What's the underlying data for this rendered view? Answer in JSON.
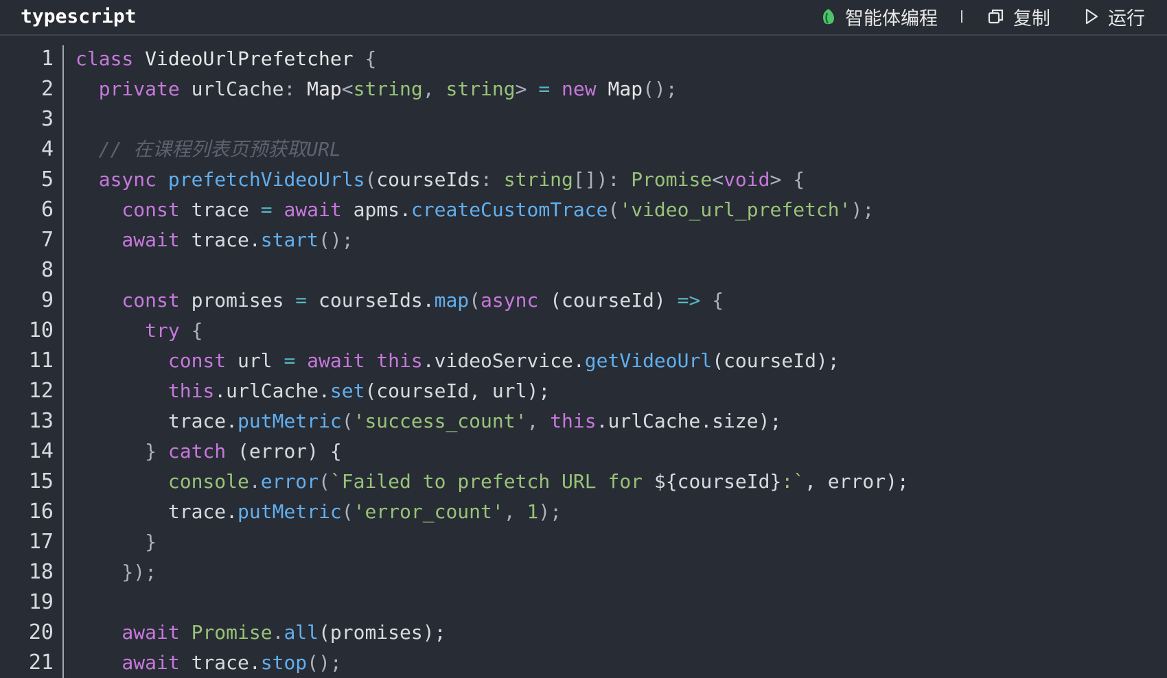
{
  "header": {
    "language": "typescript",
    "agent_label": "智能体编程",
    "copy_label": "复制",
    "run_label": "运行"
  },
  "colors": {
    "background": "#282c34",
    "keyword": "#c678dd",
    "function": "#61afef",
    "string": "#98c379",
    "comment": "#5c6370",
    "agent_icon": "#4cc46a"
  },
  "icons": {
    "agent": "leaf-icon",
    "copy": "copy-icon",
    "run": "play-icon"
  },
  "line_numbers": [
    "1",
    "2",
    "3",
    "4",
    "5",
    "6",
    "7",
    "8",
    "9",
    "10",
    "11",
    "12",
    "13",
    "14",
    "15",
    "16",
    "17",
    "18",
    "19",
    "20",
    "21"
  ],
  "code_lines": [
    [
      {
        "t": "class",
        "c": "kw"
      },
      {
        "t": " VideoUrlPrefetcher ",
        "c": "cls"
      },
      {
        "t": "{",
        "c": "plain"
      }
    ],
    [
      {
        "t": "  private",
        "c": "kw"
      },
      {
        "t": " urlCache",
        "c": "id"
      },
      {
        "t": ": ",
        "c": "plain"
      },
      {
        "t": "Map",
        "c": "cls"
      },
      {
        "t": "<",
        "c": "plain"
      },
      {
        "t": "string",
        "c": "ty"
      },
      {
        "t": ", ",
        "c": "plain"
      },
      {
        "t": "string",
        "c": "ty"
      },
      {
        "t": "> ",
        "c": "plain"
      },
      {
        "t": "=",
        "c": "op"
      },
      {
        "t": " new",
        "c": "kw"
      },
      {
        "t": " Map",
        "c": "cls"
      },
      {
        "t": "();",
        "c": "plain"
      }
    ],
    [],
    [
      {
        "t": "  // 在课程列表页预获取URL",
        "c": "cm"
      }
    ],
    [
      {
        "t": "  async",
        "c": "kw"
      },
      {
        "t": " prefetchVideoUrls",
        "c": "fn"
      },
      {
        "t": "(",
        "c": "plain"
      },
      {
        "t": "courseIds",
        "c": "id"
      },
      {
        "t": ": ",
        "c": "plain"
      },
      {
        "t": "string",
        "c": "ty"
      },
      {
        "t": "[]): ",
        "c": "plain"
      },
      {
        "t": "Promise",
        "c": "ty"
      },
      {
        "t": "<",
        "c": "plain"
      },
      {
        "t": "void",
        "c": "kw"
      },
      {
        "t": "> {",
        "c": "plain"
      }
    ],
    [
      {
        "t": "    const",
        "c": "kw"
      },
      {
        "t": " trace ",
        "c": "id"
      },
      {
        "t": "=",
        "c": "op"
      },
      {
        "t": " await",
        "c": "kw"
      },
      {
        "t": " apms.",
        "c": "id"
      },
      {
        "t": "createCustomTrace",
        "c": "fn"
      },
      {
        "t": "(",
        "c": "plain"
      },
      {
        "t": "'video_url_prefetch'",
        "c": "str"
      },
      {
        "t": ");",
        "c": "plain"
      }
    ],
    [
      {
        "t": "    await",
        "c": "kw"
      },
      {
        "t": " trace.",
        "c": "id"
      },
      {
        "t": "start",
        "c": "fn"
      },
      {
        "t": "();",
        "c": "plain"
      }
    ],
    [],
    [
      {
        "t": "    const",
        "c": "kw"
      },
      {
        "t": " promises ",
        "c": "id"
      },
      {
        "t": "=",
        "c": "op"
      },
      {
        "t": " courseIds.",
        "c": "id"
      },
      {
        "t": "map",
        "c": "fn"
      },
      {
        "t": "(",
        "c": "plain"
      },
      {
        "t": "async",
        "c": "kw"
      },
      {
        "t": " (courseId) ",
        "c": "id"
      },
      {
        "t": "=>",
        "c": "op"
      },
      {
        "t": " {",
        "c": "plain"
      }
    ],
    [
      {
        "t": "      try",
        "c": "kw"
      },
      {
        "t": " {",
        "c": "plain"
      }
    ],
    [
      {
        "t": "        const",
        "c": "kw"
      },
      {
        "t": " url ",
        "c": "id"
      },
      {
        "t": "=",
        "c": "op"
      },
      {
        "t": " await",
        "c": "kw"
      },
      {
        "t": " this",
        "c": "kw"
      },
      {
        "t": ".videoService.",
        "c": "id"
      },
      {
        "t": "getVideoUrl",
        "c": "fn"
      },
      {
        "t": "(courseId);",
        "c": "id"
      }
    ],
    [
      {
        "t": "        this",
        "c": "kw"
      },
      {
        "t": ".urlCache.",
        "c": "id"
      },
      {
        "t": "set",
        "c": "fn"
      },
      {
        "t": "(courseId, url);",
        "c": "id"
      }
    ],
    [
      {
        "t": "        trace.",
        "c": "id"
      },
      {
        "t": "putMetric",
        "c": "fn"
      },
      {
        "t": "(",
        "c": "plain"
      },
      {
        "t": "'success_count'",
        "c": "str"
      },
      {
        "t": ", ",
        "c": "plain"
      },
      {
        "t": "this",
        "c": "kw"
      },
      {
        "t": ".urlCache.size);",
        "c": "id"
      }
    ],
    [
      {
        "t": "      } ",
        "c": "plain"
      },
      {
        "t": "catch",
        "c": "kw"
      },
      {
        "t": " (error) {",
        "c": "id"
      }
    ],
    [
      {
        "t": "        console",
        "c": "ty"
      },
      {
        "t": ".",
        "c": "plain"
      },
      {
        "t": "error",
        "c": "fn"
      },
      {
        "t": "(",
        "c": "plain"
      },
      {
        "t": "`Failed to prefetch URL for ",
        "c": "str"
      },
      {
        "t": "${courseId}",
        "c": "id"
      },
      {
        "t": ":`",
        "c": "str"
      },
      {
        "t": ", error);",
        "c": "id"
      }
    ],
    [
      {
        "t": "        trace.",
        "c": "id"
      },
      {
        "t": "putMetric",
        "c": "fn"
      },
      {
        "t": "(",
        "c": "plain"
      },
      {
        "t": "'error_count'",
        "c": "str"
      },
      {
        "t": ", ",
        "c": "plain"
      },
      {
        "t": "1",
        "c": "ty"
      },
      {
        "t": ");",
        "c": "plain"
      }
    ],
    [
      {
        "t": "      }",
        "c": "plain"
      }
    ],
    [
      {
        "t": "    });",
        "c": "plain"
      }
    ],
    [],
    [
      {
        "t": "    await",
        "c": "kw"
      },
      {
        "t": " Promise",
        "c": "ty"
      },
      {
        "t": ".",
        "c": "plain"
      },
      {
        "t": "all",
        "c": "fn"
      },
      {
        "t": "(promises);",
        "c": "id"
      }
    ],
    [
      {
        "t": "    await",
        "c": "kw"
      },
      {
        "t": " trace.",
        "c": "id"
      },
      {
        "t": "stop",
        "c": "fn"
      },
      {
        "t": "();",
        "c": "plain"
      }
    ]
  ]
}
